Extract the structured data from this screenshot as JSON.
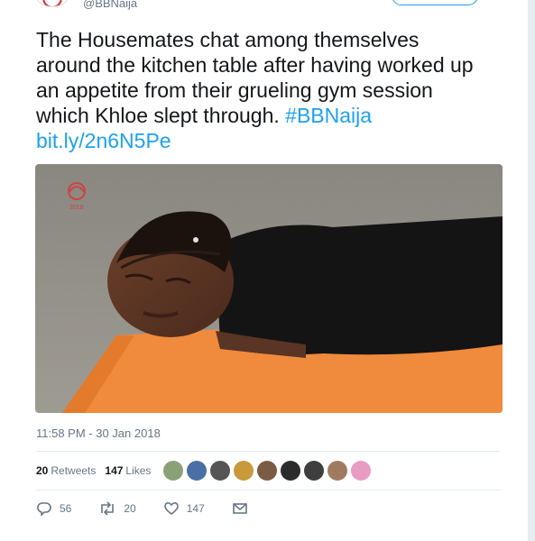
{
  "header": {
    "handle": "@BBNaija"
  },
  "tweet": {
    "text": "The Housemates chat among themselves around the kitchen table after having worked up an appetite from their grueling gym session which Khloe slept through.",
    "hashtag": "#BBNaija",
    "link": "bit.ly/2n6N5Pe"
  },
  "media": {
    "watermark_year": "2018"
  },
  "meta": {
    "timestamp": "11:58 PM - 30 Jan 2018"
  },
  "stats": {
    "retweets_count": "20",
    "retweets_label": "Retweets",
    "likes_count": "147",
    "likes_label": "Likes"
  },
  "liker_avatars": [
    "liker-avatar-1",
    "liker-avatar-2",
    "liker-avatar-3",
    "liker-avatar-4",
    "liker-avatar-5",
    "liker-avatar-6",
    "liker-avatar-7",
    "liker-avatar-8",
    "liker-avatar-9"
  ],
  "actions": {
    "reply_count": "56",
    "retweet_count": "20",
    "like_count": "147"
  },
  "colors": {
    "link": "#1da1f2",
    "muted": "#657786",
    "mat": "#f08a3c"
  },
  "icons": [
    "reply-icon",
    "retweet-icon",
    "heart-icon",
    "message-icon"
  ]
}
